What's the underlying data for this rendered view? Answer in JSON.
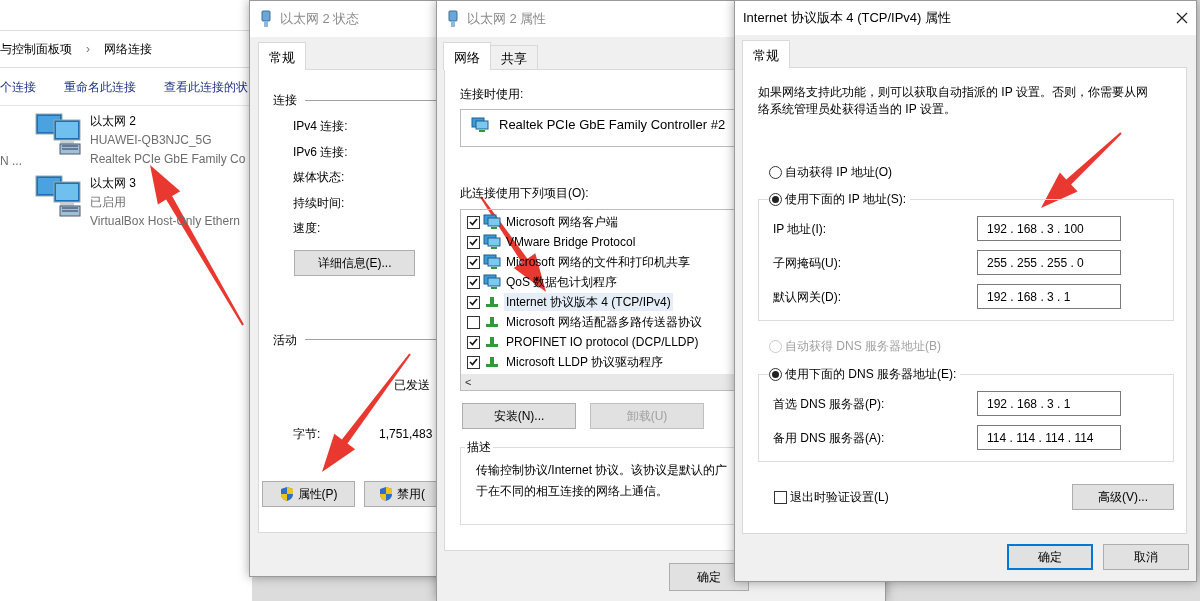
{
  "explorer": {
    "breadcrumb": [
      {
        "label": "与控制面板项"
      },
      {
        "label": "网络连接"
      }
    ],
    "breadcrumb_separator": "›",
    "toolbar": [
      "个连接",
      "重命名此连接",
      "查看此连接的状"
    ],
    "left_fragment": "N ...",
    "connections": [
      {
        "name": "以太网 2",
        "status": "HUAWEI-QB3NJC_5G",
        "device": "Realtek PCIe GbE Family Co"
      },
      {
        "name": "以太网 3",
        "status": "已启用",
        "device": "VirtualBox Host-Only Ethern"
      }
    ]
  },
  "status_dialog": {
    "title": "以太网 2 状态",
    "tabs": [
      {
        "label": "常规",
        "selected": true
      }
    ],
    "connection_group": "连接",
    "fields": [
      "IPv4 连接:",
      "IPv6 连接:",
      "媒体状态:",
      "持续时间:",
      "速度:"
    ],
    "details_button": "详细信息(E)...",
    "activity_group": "活动",
    "sent_header": "已发送",
    "bytes_label": "字节:",
    "bytes_sent": "1,751,483",
    "buttons": [
      {
        "label": "属性(P)"
      },
      {
        "label": "禁用("
      }
    ]
  },
  "properties_dialog": {
    "title": "以太网 2 属性",
    "tabs": [
      {
        "label": "网络",
        "selected": true
      },
      {
        "label": "共享",
        "selected": false
      }
    ],
    "connect_using_label": "连接时使用:",
    "adapter": "Realtek PCIe GbE Family Controller #2",
    "items_label": "此连接使用下列项目(O):",
    "items": [
      {
        "label": "Microsoft 网络客户端",
        "checked": true,
        "selected": false,
        "kind": "client"
      },
      {
        "label": "VMware Bridge Protocol",
        "checked": true,
        "selected": false,
        "kind": "service"
      },
      {
        "label": "Microsoft 网络的文件和打印机共享",
        "checked": true,
        "selected": false,
        "kind": "service"
      },
      {
        "label": "QoS 数据包计划程序",
        "checked": true,
        "selected": false,
        "kind": "service"
      },
      {
        "label": "Internet 协议版本 4 (TCP/IPv4)",
        "checked": true,
        "selected": true,
        "kind": "protocol"
      },
      {
        "label": "Microsoft 网络适配器多路传送器协议",
        "checked": false,
        "selected": false,
        "kind": "protocol"
      },
      {
        "label": "PROFINET IO protocol (DCP/LLDP)",
        "checked": true,
        "selected": false,
        "kind": "protocol"
      },
      {
        "label": "Microsoft LLDP 协议驱动程序",
        "checked": true,
        "selected": false,
        "kind": "protocol"
      }
    ],
    "scroll_left": "<",
    "buttons": [
      {
        "label": "安装(N)...",
        "disabled": false
      },
      {
        "label": "卸载(U)",
        "disabled": true
      }
    ],
    "description_group": "描述",
    "description_lines": [
      "传输控制协议/Internet 协议。该协议是默认的广",
      "于在不同的相互连接的网络上通信。"
    ],
    "ok_button": "确定"
  },
  "ipv4_dialog": {
    "title": "Internet 协议版本 4 (TCP/IPv4) 属性",
    "tabs": [
      {
        "label": "常规",
        "selected": true
      }
    ],
    "intro": "如果网络支持此功能，则可以获取自动指派的 IP 设置。否则，你需要从网络系统管理员处获得适当的 IP 设置。",
    "ip_mode": [
      {
        "label": "自动获得 IP 地址(O)",
        "selected": false,
        "disabled": false
      },
      {
        "label": "使用下面的 IP 地址(S):",
        "selected": true,
        "disabled": false
      }
    ],
    "ip_fields": [
      {
        "label": "IP 地址(I):",
        "value": "192 . 168 . 3 . 100"
      },
      {
        "label": "子网掩码(U):",
        "value": "255 . 255 . 255 . 0"
      },
      {
        "label": "默认网关(D):",
        "value": "192 . 168 . 3 . 1"
      }
    ],
    "dns_mode": [
      {
        "label": "自动获得 DNS 服务器地址(B)",
        "selected": false,
        "disabled": true
      },
      {
        "label": "使用下面的 DNS 服务器地址(E):",
        "selected": true,
        "disabled": false
      }
    ],
    "dns_fields": [
      {
        "label": "首选 DNS 服务器(P):",
        "value": "192 . 168 . 3 . 1"
      },
      {
        "label": "备用 DNS 服务器(A):",
        "value": "114 . 114 . 114 . 114"
      }
    ],
    "validate_on_exit": {
      "label": "退出时验证设置(L)",
      "checked": false
    },
    "advanced_button": "高级(V)...",
    "buttons": [
      {
        "label": "确定",
        "default": true
      },
      {
        "label": "取消",
        "default": false
      }
    ]
  }
}
